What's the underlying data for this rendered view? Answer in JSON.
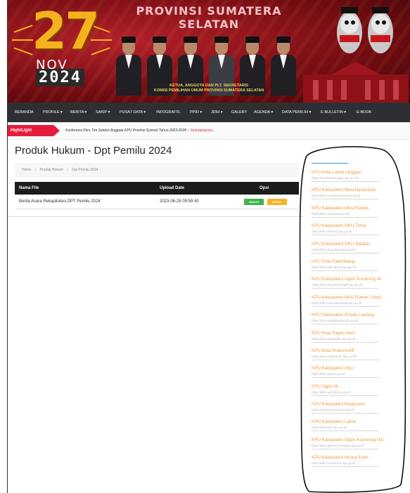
{
  "banner": {
    "title": "PROVINSI SUMATERA SELATAN",
    "date_day": "27",
    "date_month": "NOV",
    "date_year": "2024",
    "caption_line1": "KETUA, ANGGOTA DAN PLT. SEKRETARIS",
    "caption_line2": "KOMISI PEMILIHAN UMUM PROVINSI SUMATERA SELATAN"
  },
  "nav": {
    "items": [
      {
        "label": "BERANDA"
      },
      {
        "label": "PROFILE ▾"
      },
      {
        "label": "BERITA ▾"
      },
      {
        "label": "SAKIP ▾"
      },
      {
        "label": "PUSAT DATA ▾"
      },
      {
        "label": "INFOGRAFIS"
      },
      {
        "label": "PPID ▾"
      },
      {
        "label": "JDIH ▾"
      },
      {
        "label": "GALERY"
      },
      {
        "label": "AGENDA ▾"
      },
      {
        "label": "DATA PEMILIH ▾"
      },
      {
        "label": "E-BULLETIN ▾"
      },
      {
        "label": "E-BOOK"
      }
    ]
  },
  "highlight": {
    "label": "HightLight",
    "text": "Konferensi Pers Tim Seleksi Anggota KPU Provinsi Sumsel Tahun 2023-2028 –",
    "more": "Selengkapnya..."
  },
  "page": {
    "title": "Produk Hukum - Dpt Pemilu 2024",
    "breadcrumb": {
      "home": "Home",
      "section": "Produk Hukum",
      "current": "Dpt Pemilu 2024",
      "sep": "›"
    }
  },
  "table": {
    "headers": {
      "name": "Nama File",
      "date": "Upload Date",
      "opsi": "Opsi"
    },
    "rows": [
      {
        "name": "Berita Acara Rekapitulasi DPT Pemilu 2024",
        "date": "2023-06-28 09:59:40",
        "btn1": "UNDUH",
        "btn2": "DETAIL"
      }
    ]
  },
  "sidebar": {
    "items": [
      {
        "name": "KPU Kota Lubuk Linggau",
        "url": "https://kota-lubuklinggau.kpu.go.id/"
      },
      {
        "name": "KPU Kabupaten Musi Banyuasin",
        "url": "https://kab-musibanyuasin.kpu.go.id/"
      },
      {
        "name": "KPU Kabupaten Musi Rawas",
        "url": "https://kpu-musirawas.go.id/"
      },
      {
        "name": "KPU Kabupaten OKU Timur",
        "url": "https://kab-okutimur.kpu.go.id/"
      },
      {
        "name": "KPU Kabupaten OKU Selatan",
        "url": "https://kab-okuselatan.kpu.go.id/"
      },
      {
        "name": "KPU Kota Palembang",
        "url": "https://kota-palembang.kpu.go.id/"
      },
      {
        "name": "KPU Kabupaten Ogan Komering Ilir",
        "url": "https://kab-ogankomeringilir.kpu.go.id/"
      },
      {
        "name": "KPU Kabupaten Musi Rawas Utara",
        "url": "https://kab-musirawasutara.kpu.go.id/"
      },
      {
        "name": "KPU Kabupaten Empat Lawang",
        "url": "https://kab-empatlawang.kpu.go.id/"
      },
      {
        "name": "KPU Kota Pagar Alam",
        "url": "https://kota-pagaralam.kpu.go.id/"
      },
      {
        "name": "KPU Kota Prabumulih",
        "url": "https://kota-prabumulih.kpu.go.id/"
      },
      {
        "name": "KPU Kabupaten PALI",
        "url": "https://kab-pali.kpu.go.id/"
      },
      {
        "name": "KPU Ogan Ilir",
        "url": "https://kab-oganilir.kpu.go.id/"
      },
      {
        "name": "KPU Kabupaten Banyuasin",
        "url": "https://kab-banyuasin.kpu.go.id/"
      },
      {
        "name": "KPU Kabupaten Lahat",
        "url": "https://kab-lahat.kpu.go.id/"
      },
      {
        "name": "KPU Kabupaten Ogan Komering Ulu",
        "url": "https://kab-ogankomeringulu.kpu.go.id/"
      },
      {
        "name": "KPU Kabupaten Muara Enim",
        "url": "https://kab-muaraenim.kpu.go.id/"
      }
    ]
  },
  "colors": {
    "accent_red": "#e51b3b",
    "link_orange": "#f39a3e",
    "nav_bg": "#2d2f33",
    "table_head": "#1c1c1c",
    "btn_green": "#3cb54a",
    "btn_yellow": "#f4b322"
  }
}
